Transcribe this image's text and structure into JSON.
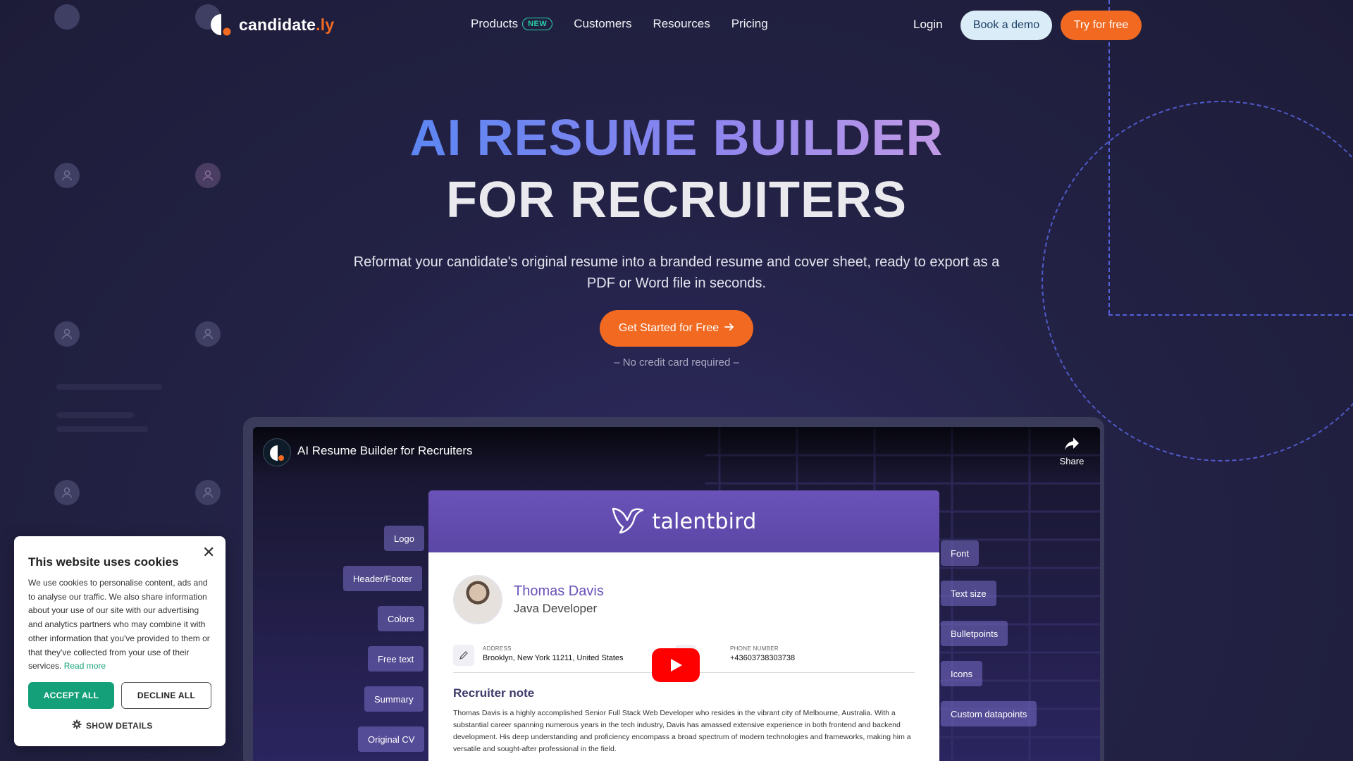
{
  "header": {
    "logo_text": "candidate",
    "logo_suffix": ".ly",
    "nav": [
      {
        "label": "Products",
        "badge": "NEW"
      },
      {
        "label": "Customers"
      },
      {
        "label": "Resources"
      },
      {
        "label": "Pricing"
      }
    ],
    "login_label": "Login",
    "demo_label": "Book a demo",
    "try_label": "Try for free"
  },
  "hero": {
    "title_line1": "AI RESUME BUILDER",
    "title_line2": "FOR RECRUITERS",
    "subtitle": "Reformat your candidate's original resume into a branded resume and cover sheet, ready to export as a PDF or Word file in seconds.",
    "cta_label": "Get Started for Free",
    "note": "– No credit card required –"
  },
  "video": {
    "title": "AI Resume Builder for Recruiters",
    "share_label": "Share",
    "left_tags": [
      "Logo",
      "Header/Footer",
      "Colors",
      "Free text",
      "Summary",
      "Original CV"
    ],
    "right_tags": [
      "Font",
      "Text size",
      "Bulletpoints",
      "Icons",
      "Custom datapoints"
    ],
    "resume": {
      "brand": "talentbird",
      "name": "Thomas Davis",
      "role": "Java Developer",
      "address_label": "ADDRESS",
      "address_value": "Brooklyn, New York 11211, United States",
      "phone_label": "PHONE NUMBER",
      "phone_value": "+43603738303738",
      "section_title": "Recruiter note",
      "section_body": "Thomas Davis is a highly accomplished Senior Full Stack Web Developer who resides in the vibrant city of Melbourne, Australia. With a substantial career spanning numerous years in the tech industry, Davis has amassed extensive experience in both frontend and backend development. His deep understanding and proficiency encompass a broad spectrum of modern technologies and frameworks, making him a versatile and sought-after professional in the field."
    }
  },
  "cookie": {
    "title": "This website uses cookies",
    "close_glyph": "✕",
    "body": "We use cookies to personalise content, ads and to analyse our traffic. We also share information about your use of our site with our advertising and analytics partners who may combine it with other information that you've provided to them or that they've collected from your use of their services.",
    "read_more": "Read more",
    "accept_label": "ACCEPT ALL",
    "decline_label": "DECLINE ALL",
    "details_label": "SHOW DETAILS"
  },
  "colors": {
    "accent_orange": "#f26a21",
    "accept_green": "#14a079",
    "brand_purple": "#6a52b8"
  }
}
